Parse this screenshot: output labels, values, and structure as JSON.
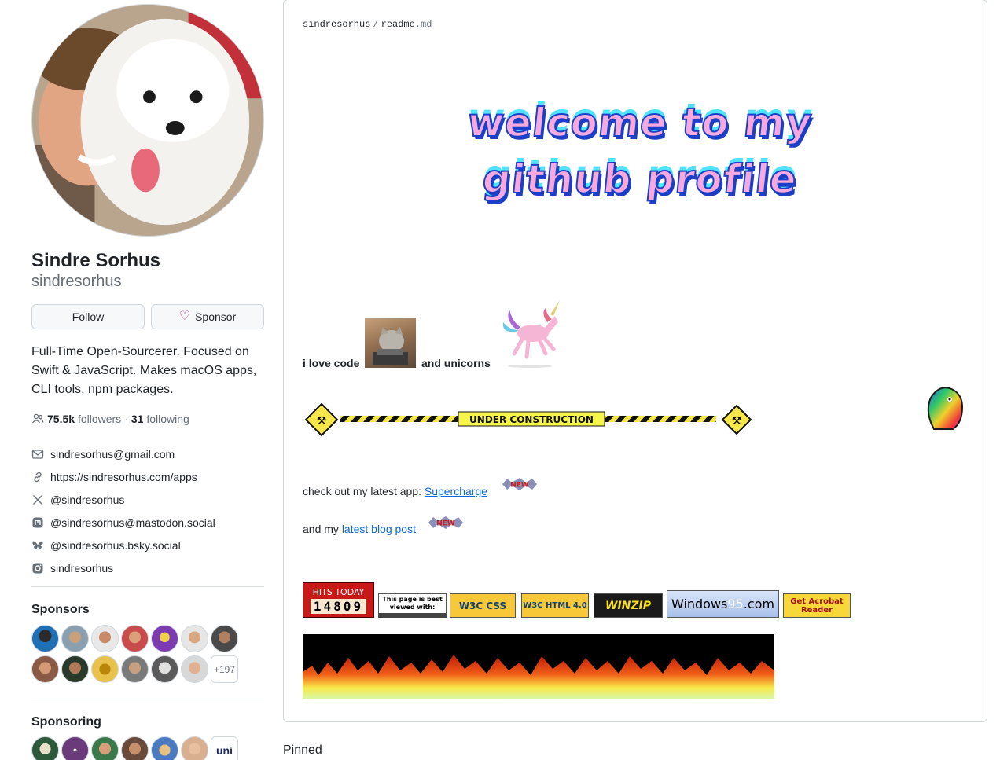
{
  "profile": {
    "name": "Sindre Sorhus",
    "login": "sindresorhus",
    "follow_label": "Follow",
    "sponsor_label": "Sponsor",
    "bio": "Full-Time Open-Sourcerer. Focused on Swift & JavaScript. Makes macOS apps, CLI tools, npm packages.",
    "followers_count": "75.5k",
    "followers_label": "followers",
    "following_count": "31",
    "following_label": "following",
    "details": [
      {
        "icon": "mail-icon",
        "text": "sindresorhus@gmail.com"
      },
      {
        "icon": "link-icon",
        "text": "https://sindresorhus.com/apps"
      },
      {
        "icon": "x-icon",
        "text": "@sindresorhus"
      },
      {
        "icon": "mastodon-icon",
        "text": "@sindresorhus@mastodon.social"
      },
      {
        "icon": "bluesky-icon",
        "text": "@sindresorhus.bsky.social"
      },
      {
        "icon": "instagram-icon",
        "text": "sindresorhus"
      }
    ]
  },
  "sponsors": {
    "heading": "Sponsors",
    "more_label": "+197",
    "avatar_colors": [
      "#1f6fb5",
      "#8aa0b0",
      "#e8e8e8",
      "#c94b4b",
      "#7d3bb0",
      "#e6e6e6",
      "#4a4a4a",
      "#8a5a44",
      "#2a3a2a",
      "#e8c24a",
      "#7a7a7a",
      "#5a5a5a",
      "#d8d8d8"
    ]
  },
  "sponsoring": {
    "heading": "Sponsoring",
    "tile_text": "uni",
    "avatar_colors": [
      "#2d5a3a",
      "#6a3a7a",
      "#3a7a4a",
      "#6a4a3a",
      "#4a7ac0",
      "#d8b090"
    ]
  },
  "readme": {
    "owner": "sindresorhus",
    "file": "readme",
    "ext": ".md",
    "welcome_line1": "welcome to my",
    "welcome_line2": "github profile",
    "love_text": "i love code",
    "unicorns_text": "and unicorns",
    "construction_text": "UNDER CONSTRUCTION",
    "app_prefix": "check out my latest app: ",
    "app_link": "Supercharge",
    "blog_prefix": "and my ",
    "blog_link": "latest blog post",
    "new_badge": "NEW",
    "hits_label": "HITS TODAY",
    "hits_count": "14809",
    "browser_badge": "This page is best viewed with:",
    "css_badge": "W3C CSS",
    "html_badge": "W3C HTML 4.0",
    "winzip_badge": "WINZIP",
    "windows_badge_a": "Windows",
    "windows_badge_b": "95",
    "windows_badge_c": ".com",
    "acrobat_badge": "Get Acrobat Reader"
  },
  "pinned_heading": "Pinned"
}
